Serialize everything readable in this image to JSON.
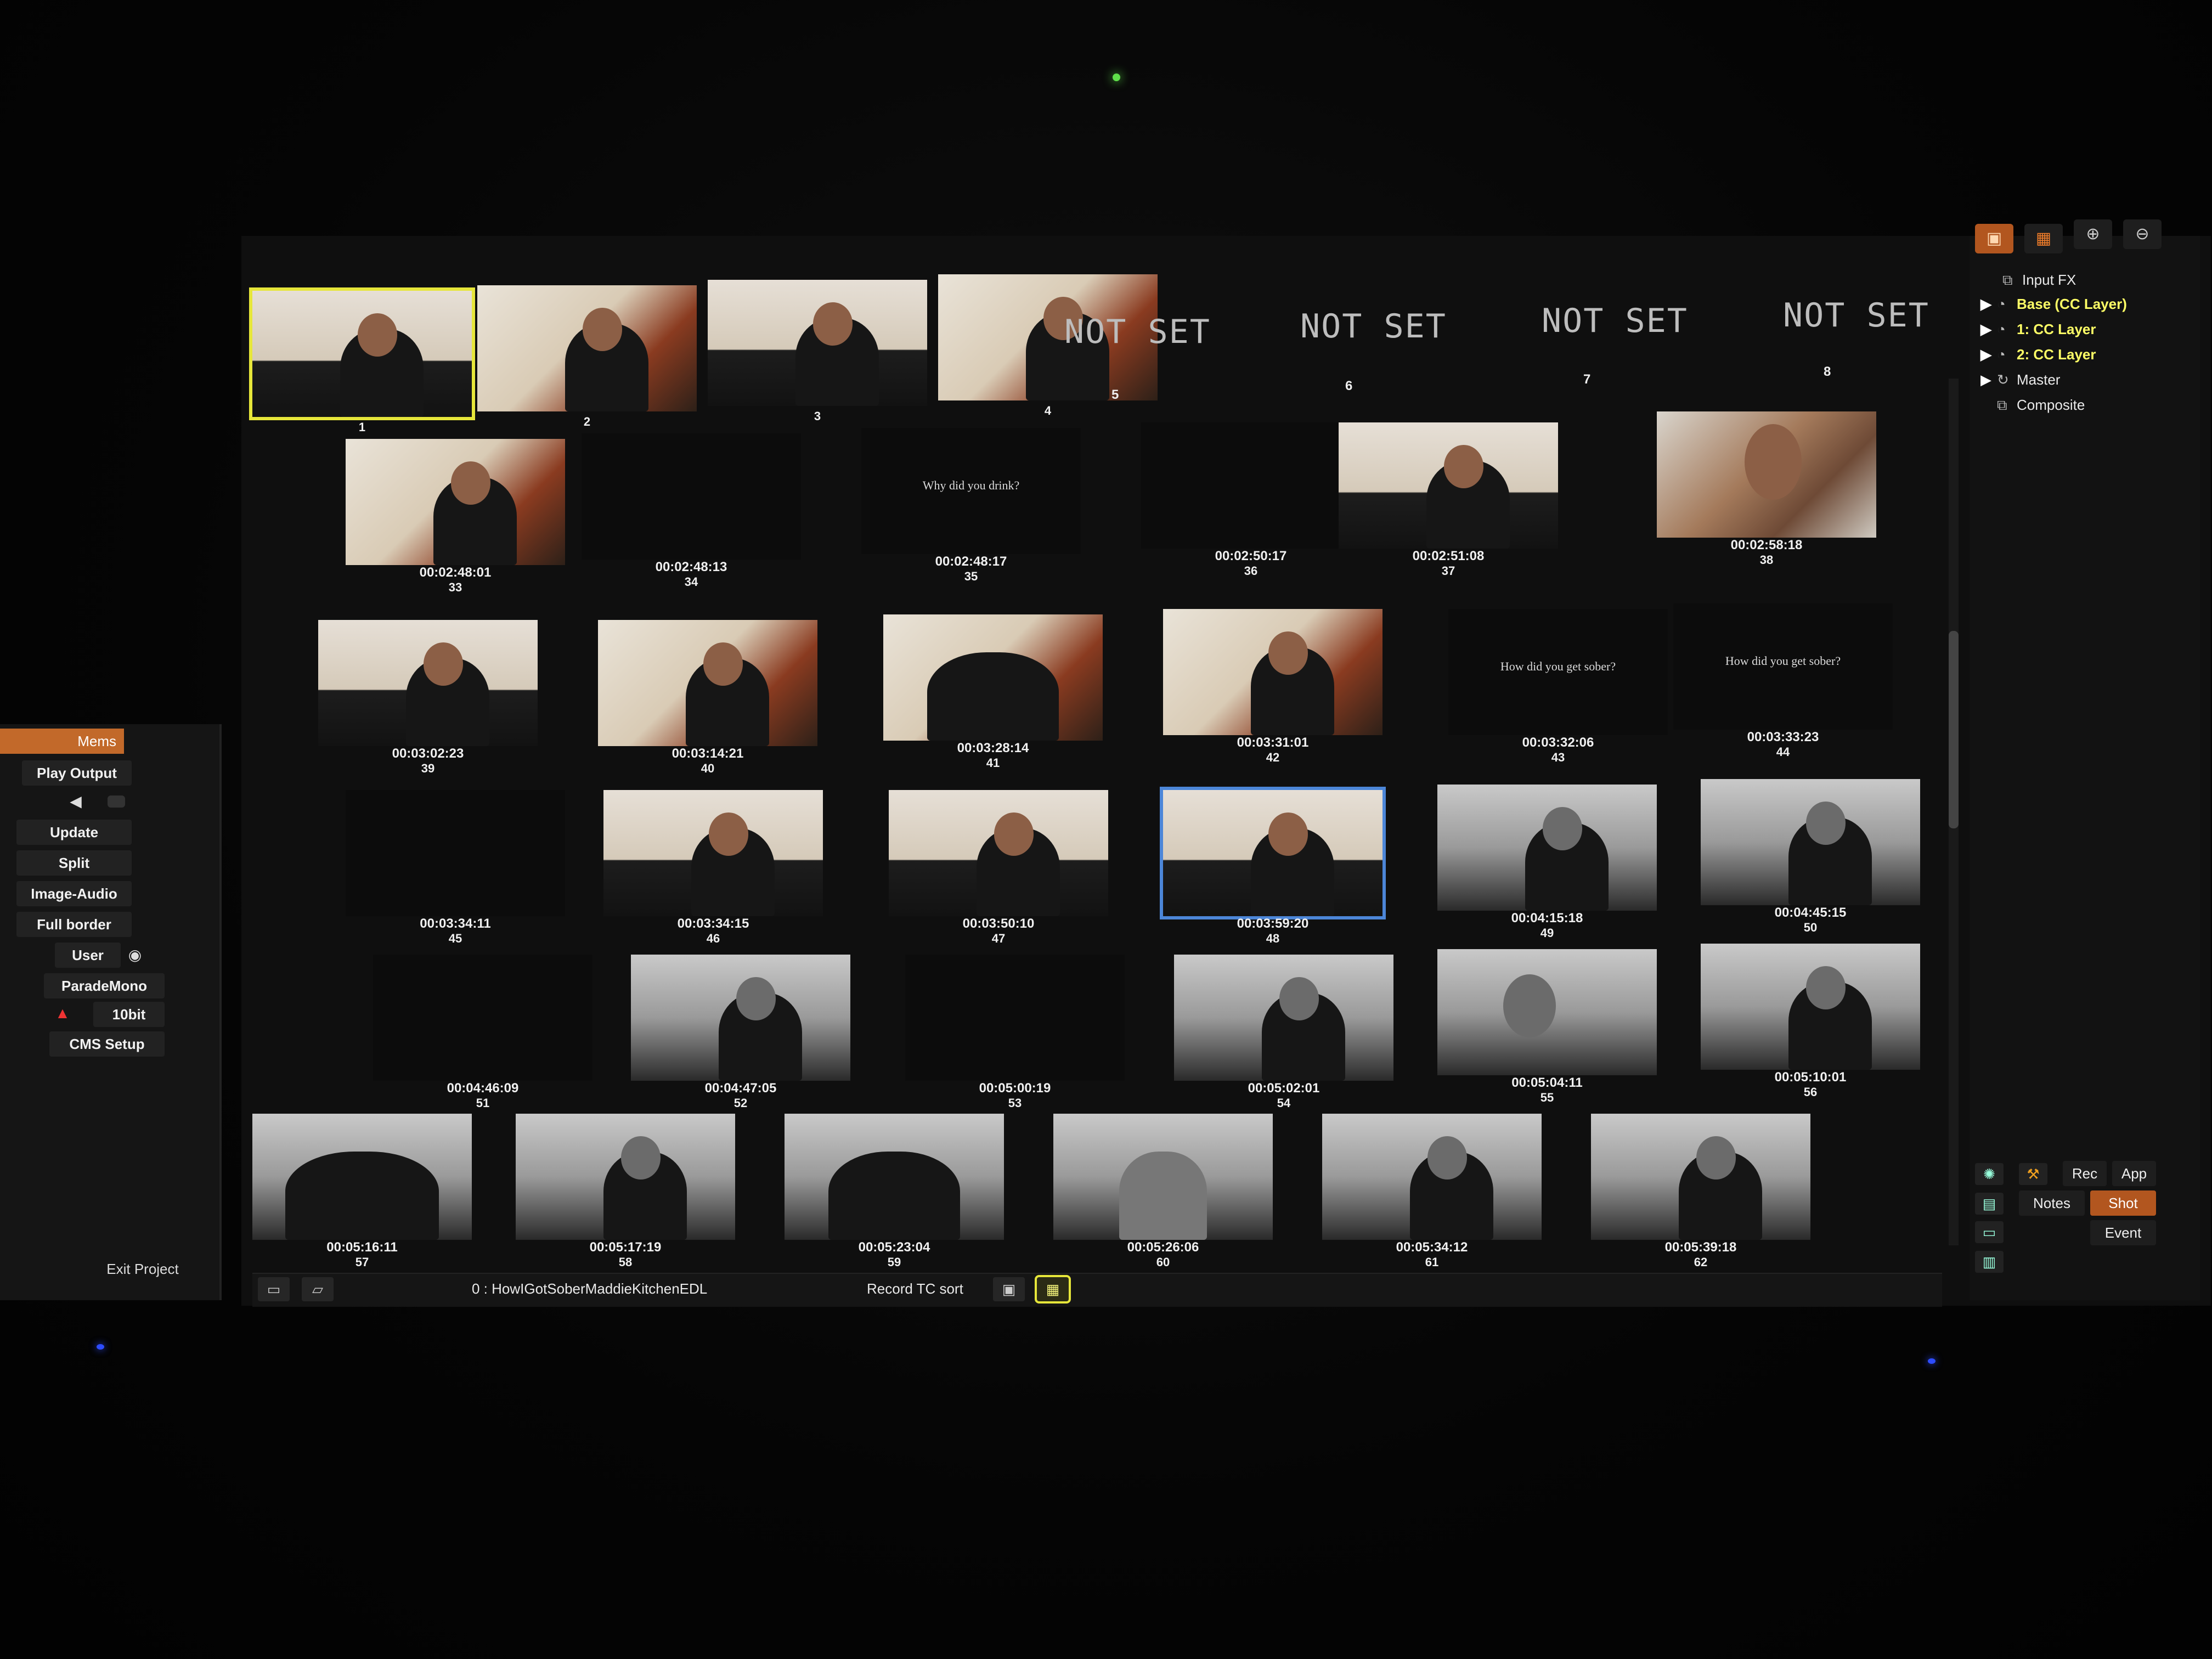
{
  "side": {
    "tab": "Mems",
    "buttons": [
      "Play Output",
      "Update",
      "Split",
      "Image-Audio",
      "Full border",
      "User",
      "ParadeMono",
      "10bit",
      "CMS Setup",
      "Exit Project"
    ]
  },
  "not_set": {
    "label": "NOT SET",
    "numbers": [
      "5",
      "6",
      "7",
      "8"
    ]
  },
  "row0": [
    {
      "num": "1"
    },
    {
      "num": "2"
    },
    {
      "num": "3"
    },
    {
      "num": "4"
    }
  ],
  "shots": [
    {
      "tc": "00:02:48:01",
      "num": "33"
    },
    {
      "tc": "00:02:48:13",
      "num": "34"
    },
    {
      "tc": "00:02:48:17",
      "num": "35",
      "caption": "Why did you drink?"
    },
    {
      "tc": "00:02:50:17",
      "num": "36"
    },
    {
      "tc": "00:02:51:08",
      "num": "37"
    },
    {
      "tc": "00:02:58:18",
      "num": "38"
    },
    {
      "tc": "00:03:02:23",
      "num": "39"
    },
    {
      "tc": "00:03:14:21",
      "num": "40"
    },
    {
      "tc": "00:03:28:14",
      "num": "41"
    },
    {
      "tc": "00:03:31:01",
      "num": "42"
    },
    {
      "tc": "00:03:32:06",
      "num": "43",
      "caption": "How did you get sober?"
    },
    {
      "tc": "00:03:33:23",
      "num": "44",
      "caption": "How did you get sober?"
    },
    {
      "tc": "00:03:34:11",
      "num": "45"
    },
    {
      "tc": "00:03:34:15",
      "num": "46"
    },
    {
      "tc": "00:03:50:10",
      "num": "47"
    },
    {
      "tc": "00:03:59:20",
      "num": "48"
    },
    {
      "tc": "00:04:15:18",
      "num": "49"
    },
    {
      "tc": "00:04:45:15",
      "num": "50"
    },
    {
      "tc": "00:04:46:09",
      "num": "51"
    },
    {
      "tc": "00:04:47:05",
      "num": "52"
    },
    {
      "tc": "00:05:00:19",
      "num": "53"
    },
    {
      "tc": "00:05:02:01",
      "num": "54"
    },
    {
      "tc": "00:05:04:11",
      "num": "55"
    },
    {
      "tc": "00:05:10:01",
      "num": "56"
    },
    {
      "tc": "00:05:16:11",
      "num": "57"
    },
    {
      "tc": "00:05:17:19",
      "num": "58"
    },
    {
      "tc": "00:05:23:04",
      "num": "59"
    },
    {
      "tc": "00:05:26:06",
      "num": "60"
    },
    {
      "tc": "00:05:34:12",
      "num": "61"
    },
    {
      "tc": "00:05:39:18",
      "num": "62"
    }
  ],
  "layers": {
    "input_fx": "Input FX",
    "base": "Base (CC Layer)",
    "cc1": "1: CC Layer",
    "cc2": "2: CC Layer",
    "master": "Master",
    "composite": "Composite"
  },
  "modes": {
    "rec": "Rec",
    "app": "App",
    "notes": "Notes",
    "shot": "Shot",
    "event": "Event"
  },
  "bottom": {
    "timeline": "0 : HowIGotSoberMaddieKitchenEDL",
    "sort": "Record TC sort"
  }
}
